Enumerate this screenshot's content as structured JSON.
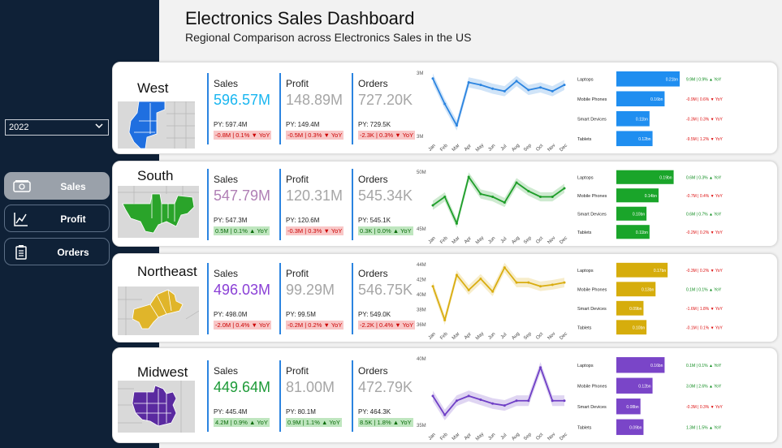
{
  "dashboard": {
    "title": "Electronics Sales Dashboard",
    "subtitle": "Regional Comparison across Electronics Sales in the US"
  },
  "sidebar": {
    "year": "2022",
    "nav": [
      {
        "label": "Sales",
        "active": true,
        "icon": "money-icon"
      },
      {
        "label": "Profit",
        "active": false,
        "icon": "line-chart-icon"
      },
      {
        "label": "Orders",
        "active": false,
        "icon": "clipboard-icon"
      }
    ]
  },
  "kpi_labels": {
    "sales": "Sales",
    "profit": "Profit",
    "orders": "Orders"
  },
  "regions": [
    {
      "name": "West",
      "map_color": "#1f6fe0",
      "sales": {
        "value": "596.57M",
        "color": "#19b6f0",
        "py": "PY: 597.4M",
        "delta": "-0.8M | 0.1% ▼ YoY",
        "up": false
      },
      "profit": {
        "value": "148.89M",
        "color": "#a6a6a6",
        "py": "PY: 149.4M",
        "delta": "-0.5M | 0.3% ▼ YoY",
        "up": false
      },
      "orders": {
        "value": "727.20K",
        "color": "#a6a6a6",
        "py": "PY: 729.5K",
        "delta": "-2.3K | 0.3% ▼ YoY",
        "up": false
      },
      "line": {
        "color": "#2b84e0",
        "ylabels": [
          "3M",
          "3M"
        ],
        "months": [
          "Jan",
          "Feb",
          "Mar",
          "Apr",
          "May",
          "Jun",
          "Jul",
          "Aug",
          "Sep",
          "Oct",
          "Nov",
          "Dec"
        ]
      },
      "products": [
        {
          "name": "Laptops",
          "bar_label": "0.21bn",
          "value": 0.21,
          "delta": "9.9M | 0.9% ▲ YoY",
          "up": true
        },
        {
          "name": "Mobile Phones",
          "bar_label": "0.16bn",
          "value": 0.16,
          "delta": "-0.9M | 0.6% ▼ YoY",
          "up": false
        },
        {
          "name": "Smart Devices",
          "bar_label": "0.11bn",
          "value": 0.11,
          "delta": "-0.3M | 0.3% ▼ YoY",
          "up": false
        },
        {
          "name": "Tablets",
          "bar_label": "0.12bn",
          "value": 0.12,
          "delta": "-9.5M | 1.2% ▼ YoY",
          "up": false
        }
      ],
      "bar_color": "#1f8ef0"
    },
    {
      "name": "South",
      "map_color": "#2aa42a",
      "sales": {
        "value": "547.79M",
        "color": "#b07fb5",
        "py": "PY: 547.3M",
        "delta": "0.5M | 0.1% ▲ YoY",
        "up": true
      },
      "profit": {
        "value": "120.31M",
        "color": "#a6a6a6",
        "py": "PY: 120.6M",
        "delta": "-0.3M | 0.3% ▼ YoY",
        "up": false
      },
      "orders": {
        "value": "545.34K",
        "color": "#a6a6a6",
        "py": "PY: 545.1K",
        "delta": "0.3K | 0.0% ▲ YoY",
        "up": true
      },
      "line": {
        "color": "#1f9e2a",
        "ylabels": [
          "50M",
          "45M"
        ],
        "months": [
          "Jan",
          "Feb",
          "Mar",
          "Apr",
          "May",
          "Jun",
          "Jul",
          "Aug",
          "Sep",
          "Oct",
          "Nov",
          "Dec"
        ]
      },
      "products": [
        {
          "name": "Laptops",
          "bar_label": "0.19bn",
          "value": 0.19,
          "delta": "0.6M | 0.3% ▲ YoY",
          "up": true
        },
        {
          "name": "Mobile Phones",
          "bar_label": "0.14bn",
          "value": 0.14,
          "delta": "-0.7M | 0.4% ▼ YoY",
          "up": false
        },
        {
          "name": "Smart Devices",
          "bar_label": "0.10bn",
          "value": 0.1,
          "delta": "0.6M | 0.7% ▲ YoY",
          "up": true
        },
        {
          "name": "Tablets",
          "bar_label": "0.11bn",
          "value": 0.11,
          "delta": "-0.2M | 0.2% ▼ YoY",
          "up": false
        }
      ],
      "bar_color": "#1aa52a"
    },
    {
      "name": "Northeast",
      "map_color": "#e0b52a",
      "sales": {
        "value": "496.03M",
        "color": "#8a3fd6",
        "py": "PY: 498.0M",
        "delta": "-2.0M | 0.4% ▼ YoY",
        "up": false
      },
      "profit": {
        "value": "99.29M",
        "color": "#a6a6a6",
        "py": "PY: 99.5M",
        "delta": "-0.2M | 0.2% ▼ YoY",
        "up": false
      },
      "orders": {
        "value": "546.75K",
        "color": "#a6a6a6",
        "py": "PY: 549.0K",
        "delta": "-2.2K | 0.4% ▼ YoY",
        "up": false
      },
      "line": {
        "color": "#d9ad10",
        "ylabels": [
          "44M",
          "42M",
          "40M",
          "38M",
          "36M"
        ],
        "months": [
          "Jan",
          "Feb",
          "Mar",
          "Apr",
          "May",
          "Jun",
          "Jul",
          "Aug",
          "Sep",
          "Oct",
          "Nov",
          "Dec"
        ]
      },
      "products": [
        {
          "name": "Laptops",
          "bar_label": "0.17bn",
          "value": 0.17,
          "delta": "-0.3M | 0.2% ▼ YoY",
          "up": false
        },
        {
          "name": "Mobile Phones",
          "bar_label": "0.13bn",
          "value": 0.13,
          "delta": "0.1M | 0.1% ▲ YoY",
          "up": true
        },
        {
          "name": "Smart Devices",
          "bar_label": "0.09bn",
          "value": 0.09,
          "delta": "-1.6M | 1.8% ▼ YoY",
          "up": false
        },
        {
          "name": "Tablets",
          "bar_label": "0.10bn",
          "value": 0.1,
          "delta": "-0.1M | 0.1% ▼ YoY",
          "up": false
        }
      ],
      "bar_color": "#d6ad0c"
    },
    {
      "name": "Midwest",
      "map_color": "#5a2aa0",
      "sales": {
        "value": "449.64M",
        "color": "#1c9a37",
        "py": "PY: 445.4M",
        "delta": "4.2M | 0.9% ▲ YoY",
        "up": true
      },
      "profit": {
        "value": "81.00M",
        "color": "#a6a6a6",
        "py": "PY: 80.1M",
        "delta": "0.9M | 1.1% ▲ YoY",
        "up": true
      },
      "orders": {
        "value": "472.79K",
        "color": "#a6a6a6",
        "py": "PY: 464.3K",
        "delta": "8.5K | 1.8% ▲ YoY",
        "up": true
      },
      "line": {
        "color": "#6f3fc6",
        "ylabels": [
          "40M",
          "35M"
        ],
        "months": [
          "Jan",
          "Feb",
          "Mar",
          "Apr",
          "May",
          "Jun",
          "Jul",
          "Aug",
          "Sep",
          "Oct",
          "Nov",
          "Dec"
        ]
      },
      "products": [
        {
          "name": "Laptops",
          "bar_label": "0.16bn",
          "value": 0.16,
          "delta": "0.1M | 0.1% ▲ YoY",
          "up": true
        },
        {
          "name": "Mobile Phones",
          "bar_label": "0.12bn",
          "value": 0.12,
          "delta": "3.0M | 2.6% ▲ YoY",
          "up": true
        },
        {
          "name": "Smart Devices",
          "bar_label": "0.08bn",
          "value": 0.08,
          "delta": "-0.3M | 0.3% ▼ YoY",
          "up": false
        },
        {
          "name": "Tablets",
          "bar_label": "0.09bn",
          "value": 0.09,
          "delta": "1.3M | 1.5% ▲ YoY",
          "up": true
        }
      ],
      "bar_color": "#7a45c8"
    }
  ],
  "chart_data": [
    {
      "type": "line",
      "region": "West",
      "x": [
        "Jan",
        "Feb",
        "Mar",
        "Apr",
        "May",
        "Jun",
        "Jul",
        "Aug",
        "Sep",
        "Oct",
        "Nov",
        "Dec"
      ],
      "values": [
        50.5,
        48.5,
        46.8,
        50.2,
        50.0,
        49.7,
        49.5,
        50.3,
        49.6,
        49.8,
        49.5,
        50.0
      ],
      "ylim": [
        46,
        51
      ]
    },
    {
      "type": "line",
      "region": "South",
      "x": [
        "Jan",
        "Feb",
        "Mar",
        "Apr",
        "May",
        "Jun",
        "Jul",
        "Aug",
        "Sep",
        "Oct",
        "Nov",
        "Dec"
      ],
      "values": [
        44.0,
        45.5,
        40.8,
        49.0,
        46.0,
        45.5,
        44.5,
        48.0,
        46.5,
        45.5,
        45.5,
        47.0
      ],
      "ylim": [
        40,
        50
      ]
    },
    {
      "type": "line",
      "region": "Northeast",
      "x": [
        "Jan",
        "Feb",
        "Mar",
        "Apr",
        "May",
        "Jun",
        "Jul",
        "Aug",
        "Sep",
        "Oct",
        "Nov",
        "Dec"
      ],
      "values": [
        41.0,
        36.5,
        42.5,
        40.5,
        42.0,
        40.3,
        43.5,
        41.5,
        41.5,
        41.0,
        41.2,
        41.5
      ],
      "ylim": [
        36,
        44
      ]
    },
    {
      "type": "line",
      "region": "Midwest",
      "x": [
        "Jan",
        "Feb",
        "Mar",
        "Apr",
        "May",
        "Jun",
        "Jul",
        "Aug",
        "Sep",
        "Oct",
        "Nov",
        "Dec"
      ],
      "values": [
        37.0,
        35.0,
        36.5,
        37.0,
        36.6,
        36.2,
        36.0,
        36.5,
        36.5,
        40.0,
        36.5,
        36.5
      ],
      "ylim": [
        34,
        41
      ]
    }
  ]
}
